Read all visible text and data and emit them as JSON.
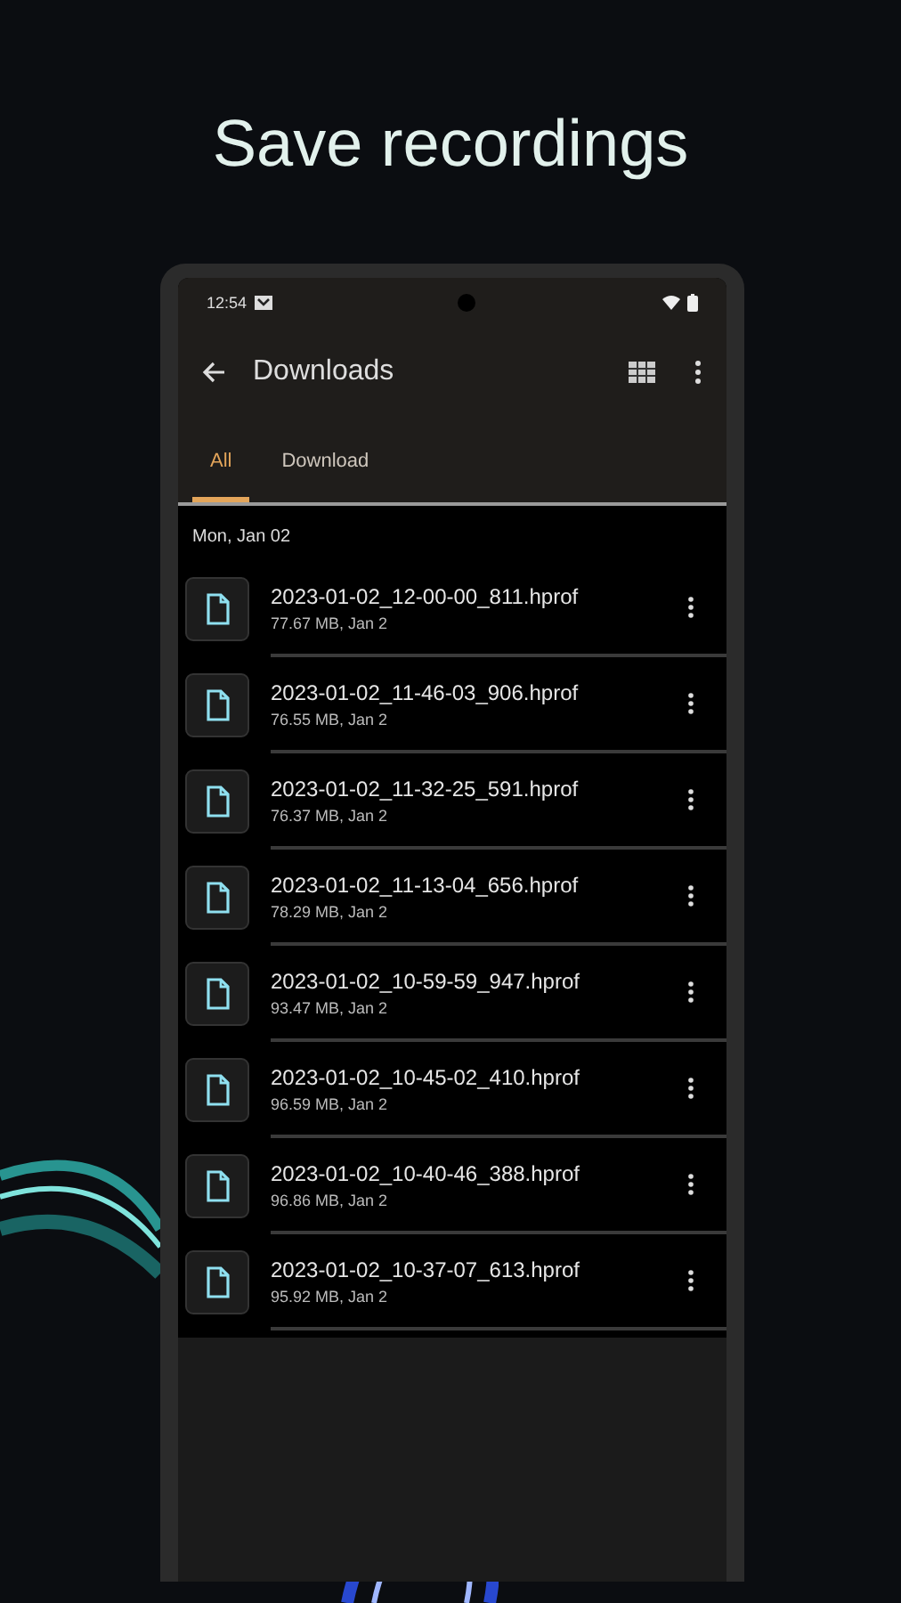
{
  "headline": "Save recordings",
  "status_bar": {
    "time": "12:54"
  },
  "app_bar": {
    "title": "Downloads"
  },
  "tabs": [
    {
      "label": "All",
      "selected": true
    },
    {
      "label": "Download",
      "selected": false
    }
  ],
  "section": {
    "date": "Mon, Jan 02"
  },
  "files": [
    {
      "name": "2023-01-02_12-00-00_811.hprof",
      "details": "77.67 MB, Jan 2"
    },
    {
      "name": "2023-01-02_11-46-03_906.hprof",
      "details": "76.55 MB, Jan 2"
    },
    {
      "name": "2023-01-02_11-32-25_591.hprof",
      "details": "76.37 MB, Jan 2"
    },
    {
      "name": "2023-01-02_11-13-04_656.hprof",
      "details": "78.29 MB, Jan 2"
    },
    {
      "name": "2023-01-02_10-59-59_947.hprof",
      "details": "93.47 MB, Jan 2"
    },
    {
      "name": "2023-01-02_10-45-02_410.hprof",
      "details": "96.59 MB, Jan 2"
    },
    {
      "name": "2023-01-02_10-40-46_388.hprof",
      "details": "96.86 MB, Jan 2"
    },
    {
      "name": "2023-01-02_10-37-07_613.hprof",
      "details": "95.92 MB, Jan 2"
    }
  ]
}
